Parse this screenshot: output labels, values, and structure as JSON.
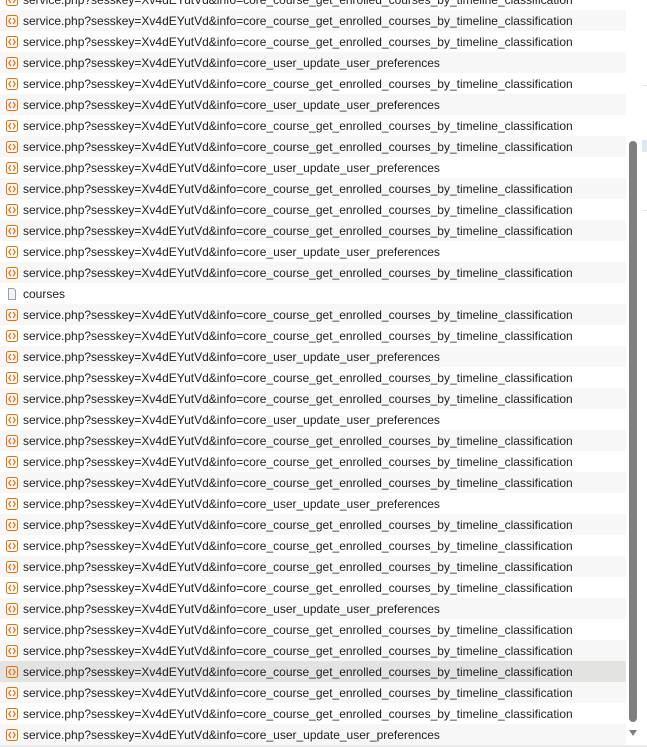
{
  "requests": [
    {
      "name": "service.php?sesskey=Xv4dEYutVd&info=core_course_get_enrolled_courses_by_timeline_classification",
      "type": "xhr-icon"
    },
    {
      "name": "service.php?sesskey=Xv4dEYutVd&info=core_course_get_enrolled_courses_by_timeline_classification",
      "type": "xhr-icon"
    },
    {
      "name": "service.php?sesskey=Xv4dEYutVd&info=core_course_get_enrolled_courses_by_timeline_classification",
      "type": "xhr-icon"
    },
    {
      "name": "service.php?sesskey=Xv4dEYutVd&info=core_user_update_user_preferences",
      "type": "xhr-icon"
    },
    {
      "name": "service.php?sesskey=Xv4dEYutVd&info=core_course_get_enrolled_courses_by_timeline_classification",
      "type": "xhr-icon"
    },
    {
      "name": "service.php?sesskey=Xv4dEYutVd&info=core_user_update_user_preferences",
      "type": "xhr-icon"
    },
    {
      "name": "service.php?sesskey=Xv4dEYutVd&info=core_course_get_enrolled_courses_by_timeline_classification",
      "type": "xhr-icon"
    },
    {
      "name": "service.php?sesskey=Xv4dEYutVd&info=core_course_get_enrolled_courses_by_timeline_classification",
      "type": "xhr-icon"
    },
    {
      "name": "service.php?sesskey=Xv4dEYutVd&info=core_user_update_user_preferences",
      "type": "xhr-icon"
    },
    {
      "name": "service.php?sesskey=Xv4dEYutVd&info=core_course_get_enrolled_courses_by_timeline_classification",
      "type": "xhr-icon"
    },
    {
      "name": "service.php?sesskey=Xv4dEYutVd&info=core_course_get_enrolled_courses_by_timeline_classification",
      "type": "xhr-icon"
    },
    {
      "name": "service.php?sesskey=Xv4dEYutVd&info=core_course_get_enrolled_courses_by_timeline_classification",
      "type": "xhr-icon"
    },
    {
      "name": "service.php?sesskey=Xv4dEYutVd&info=core_user_update_user_preferences",
      "type": "xhr-icon"
    },
    {
      "name": "service.php?sesskey=Xv4dEYutVd&info=core_course_get_enrolled_courses_by_timeline_classification",
      "type": "xhr-icon"
    },
    {
      "name": "courses",
      "type": "document-icon"
    },
    {
      "name": "service.php?sesskey=Xv4dEYutVd&info=core_course_get_enrolled_courses_by_timeline_classification",
      "type": "xhr-icon"
    },
    {
      "name": "service.php?sesskey=Xv4dEYutVd&info=core_course_get_enrolled_courses_by_timeline_classification",
      "type": "xhr-icon"
    },
    {
      "name": "service.php?sesskey=Xv4dEYutVd&info=core_user_update_user_preferences",
      "type": "xhr-icon"
    },
    {
      "name": "service.php?sesskey=Xv4dEYutVd&info=core_course_get_enrolled_courses_by_timeline_classification",
      "type": "xhr-icon"
    },
    {
      "name": "service.php?sesskey=Xv4dEYutVd&info=core_course_get_enrolled_courses_by_timeline_classification",
      "type": "xhr-icon"
    },
    {
      "name": "service.php?sesskey=Xv4dEYutVd&info=core_user_update_user_preferences",
      "type": "xhr-icon"
    },
    {
      "name": "service.php?sesskey=Xv4dEYutVd&info=core_course_get_enrolled_courses_by_timeline_classification",
      "type": "xhr-icon"
    },
    {
      "name": "service.php?sesskey=Xv4dEYutVd&info=core_course_get_enrolled_courses_by_timeline_classification",
      "type": "xhr-icon"
    },
    {
      "name": "service.php?sesskey=Xv4dEYutVd&info=core_course_get_enrolled_courses_by_timeline_classification",
      "type": "xhr-icon"
    },
    {
      "name": "service.php?sesskey=Xv4dEYutVd&info=core_user_update_user_preferences",
      "type": "xhr-icon"
    },
    {
      "name": "service.php?sesskey=Xv4dEYutVd&info=core_course_get_enrolled_courses_by_timeline_classification",
      "type": "xhr-icon"
    },
    {
      "name": "service.php?sesskey=Xv4dEYutVd&info=core_course_get_enrolled_courses_by_timeline_classification",
      "type": "xhr-icon"
    },
    {
      "name": "service.php?sesskey=Xv4dEYutVd&info=core_course_get_enrolled_courses_by_timeline_classification",
      "type": "xhr-icon"
    },
    {
      "name": "service.php?sesskey=Xv4dEYutVd&info=core_course_get_enrolled_courses_by_timeline_classification",
      "type": "xhr-icon"
    },
    {
      "name": "service.php?sesskey=Xv4dEYutVd&info=core_user_update_user_preferences",
      "type": "xhr-icon"
    },
    {
      "name": "service.php?sesskey=Xv4dEYutVd&info=core_course_get_enrolled_courses_by_timeline_classification",
      "type": "xhr-icon"
    },
    {
      "name": "service.php?sesskey=Xv4dEYutVd&info=core_course_get_enrolled_courses_by_timeline_classification",
      "type": "xhr-icon"
    },
    {
      "name": "service.php?sesskey=Xv4dEYutVd&info=core_course_get_enrolled_courses_by_timeline_classification",
      "type": "xhr-icon",
      "selected": true
    },
    {
      "name": "service.php?sesskey=Xv4dEYutVd&info=core_course_get_enrolled_courses_by_timeline_classification",
      "type": "xhr-icon"
    },
    {
      "name": "service.php?sesskey=Xv4dEYutVd&info=core_course_get_enrolled_courses_by_timeline_classification",
      "type": "xhr-icon"
    },
    {
      "name": "service.php?sesskey=Xv4dEYutVd&info=core_user_update_user_preferences",
      "type": "xhr-icon"
    }
  ],
  "colors": {
    "xhr_icon": "#e8710a",
    "document_icon": "#9aa0a6",
    "row_alt": "#f7f7f7",
    "row_selected": "#e3e3e1",
    "text": "#202124",
    "scroll_thumb": "#7f7f7f"
  }
}
